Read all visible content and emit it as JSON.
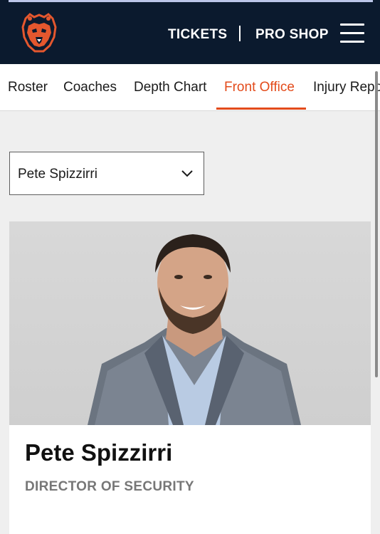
{
  "header": {
    "logo_icon": "bears-logo-icon",
    "tickets_label": "TICKETS",
    "proshop_label": "PRO SHOP",
    "menu_icon": "hamburger-menu-icon"
  },
  "tabs": [
    {
      "label": "Roster",
      "active": false
    },
    {
      "label": "Coaches",
      "active": false
    },
    {
      "label": "Depth Chart",
      "active": false
    },
    {
      "label": "Front Office",
      "active": true
    },
    {
      "label": "Injury Repo",
      "active": false
    }
  ],
  "selector": {
    "value": "Pete Spizzirri",
    "icon": "chevron-down-icon"
  },
  "profile": {
    "name": "Pete Spizzirri",
    "title": "DIRECTOR OF SECURITY"
  },
  "colors": {
    "header_bg": "#0b1a2e",
    "accent": "#e34b1b",
    "page_bg": "#efefef"
  }
}
